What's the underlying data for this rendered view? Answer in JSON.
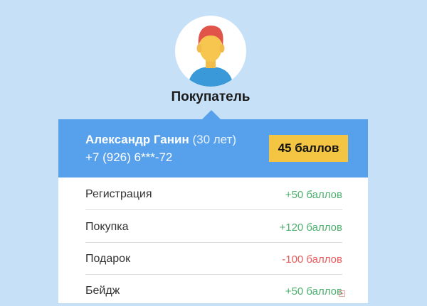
{
  "role": "Покупатель",
  "user": {
    "name": "Александр Ганин",
    "age": "(30 лет)",
    "phone": "+7 (926) 6***-72",
    "points_badge": "45 баллов"
  },
  "history": [
    {
      "label": "Регистрация",
      "value": "+50 баллов",
      "type": "positive"
    },
    {
      "label": "Покупка",
      "value": "+120 баллов",
      "type": "positive"
    },
    {
      "label": "Подарок",
      "value": "-100 баллов",
      "type": "negative"
    },
    {
      "label": "Бейдж",
      "value": "+50 баллов",
      "type": "positive"
    }
  ],
  "colors": {
    "background": "#c6e0f8",
    "header": "#56a0ec",
    "badge": "#f4c542",
    "positive": "#4caf6e",
    "negative": "#e55a5a"
  },
  "icons": {
    "avatar": "user-avatar-icon",
    "corner": "expand-icon"
  }
}
